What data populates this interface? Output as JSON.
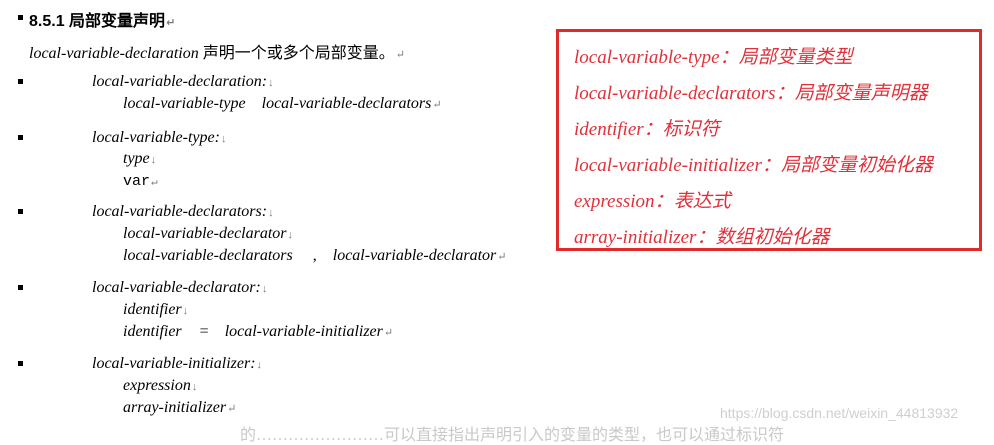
{
  "section": {
    "number": "8.5.1",
    "title": "局部变量声明"
  },
  "intro": {
    "term": "local-variable-declaration",
    "text": "声明一个或多个局部变量。"
  },
  "grammar": [
    {
      "name": "local-variable-declaration:",
      "alternatives": [
        [
          "local-variable-type",
          "local-variable-declarators"
        ]
      ]
    },
    {
      "name": "local-variable-type:",
      "alternatives": [
        [
          "type"
        ],
        [
          "var"
        ]
      ]
    },
    {
      "name": "local-variable-declarators:",
      "alternatives": [
        [
          "local-variable-declarator"
        ],
        [
          "local-variable-declarators",
          ",",
          "local-variable-declarator"
        ]
      ]
    },
    {
      "name": "local-variable-declarator:",
      "alternatives": [
        [
          "identifier"
        ],
        [
          "identifier",
          "=",
          "local-variable-initializer"
        ]
      ]
    },
    {
      "name": "local-variable-initializer:",
      "alternatives": [
        [
          "expression"
        ],
        [
          "array-initializer"
        ]
      ]
    }
  ],
  "glossary": [
    {
      "term": "local-variable-type：",
      "meaning": "局部变量类型"
    },
    {
      "term": "local-variable-declarators：",
      "meaning": "局部变量声明器"
    },
    {
      "term": "identifier：",
      "meaning": "标识符"
    },
    {
      "term": "local-variable-initializer：",
      "meaning": "局部变量初始化器"
    },
    {
      "term": "expression：",
      "meaning": "表达式"
    },
    {
      "term": "array-initializer：",
      "meaning": "数组初始化器"
    }
  ],
  "watermark": "https://blog.csdn.net/weixin_44813932",
  "truncated_line": "的……………………可以直接指出声明引入的变量的类型，也可以通过标识符"
}
